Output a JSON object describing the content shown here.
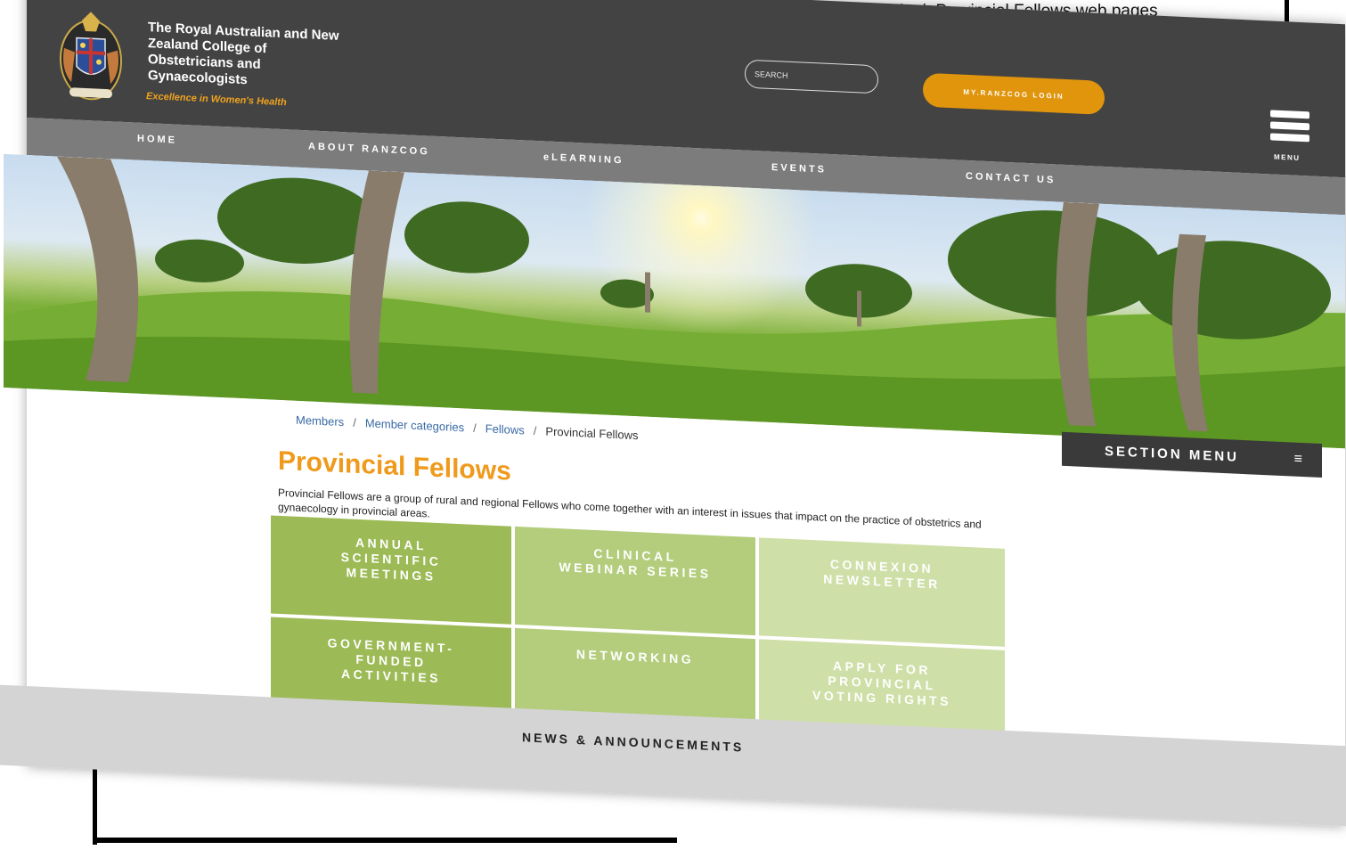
{
  "caption": "to view the new look Provincial Fellows web pages",
  "header": {
    "org_name": "The Royal Australian and New Zealand College of Obstetricians and Gynaecologists",
    "tagline": "Excellence in Women's Health",
    "search_placeholder": "SEARCH",
    "login_label": "MY.RANZCOG LOGIN",
    "menu_label": "MENU"
  },
  "nav": {
    "items": [
      "HOME",
      "ABOUT RANZCOG",
      "eLEARNING",
      "EVENTS",
      "CONTACT US"
    ]
  },
  "breadcrumb": {
    "items": [
      "Members",
      "Member categories",
      "Fellows",
      "Provincial Fellows"
    ],
    "separator": "/"
  },
  "section_menu": {
    "label": "SECTION MENU",
    "icon": "≡"
  },
  "page": {
    "title": "Provincial Fellows",
    "intro": "Provincial Fellows are a group of rural and regional Fellows who come together with an interest in issues that impact on the practice of obstetrics and gynaecology in provincial areas."
  },
  "tiles": [
    "ANNUAL\nSCIENTIFIC\nMEETINGS",
    "CLINICAL\nWEBINAR SERIES",
    "CONNEXION\nNEWSLETTER",
    "GOVERNMENT-\nFUNDED\nACTIVITIES",
    "NETWORKING",
    "APPLY FOR\nPROVINCIAL\nVOTING RIGHTS"
  ],
  "footer": {
    "news_label": "NEWS & ANNOUNCEMENTS"
  },
  "colors": {
    "header_bg": "#434343",
    "nav_bg": "#7c7c7c",
    "accent_orange": "#e0950d",
    "title_orange": "#ef9a1c",
    "tile_dark": "#9cba55",
    "tile_mid": "#b3cd7c",
    "tile_light": "#cfdfa8"
  },
  "icons": [
    "college-crest-logo",
    "hamburger-menu-icon",
    "section-menu-icon"
  ]
}
